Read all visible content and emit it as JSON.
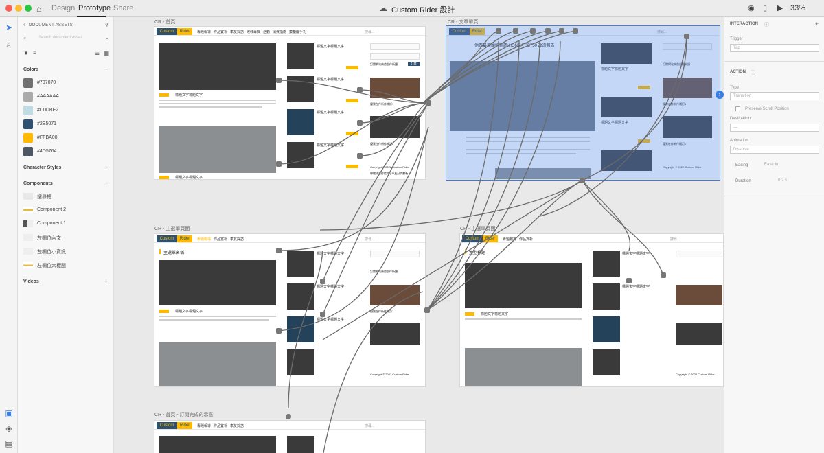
{
  "app": {
    "title": "Custom Rider 設計",
    "tabs": [
      "Design",
      "Prototype",
      "Share"
    ],
    "active_tab": "Prototype",
    "zoom": "33%"
  },
  "assets": {
    "header": "DOCUMENT ASSETS",
    "search_placeholder": "Search document asset",
    "sections": {
      "colors": "Colors",
      "character_styles": "Character Styles",
      "components": "Components",
      "videos": "Videos"
    },
    "colors": [
      {
        "hex": "#707070",
        "label": "#707070"
      },
      {
        "hex": "#AAAAAA",
        "label": "#AAAAAA"
      },
      {
        "hex": "#C0DBE2",
        "label": "#C0DBE2"
      },
      {
        "hex": "#2E5071",
        "label": "#2E5071"
      },
      {
        "hex": "#FFBA00",
        "label": "#FFBA00"
      },
      {
        "hex": "#4D5764",
        "label": "#4D5764"
      }
    ],
    "components": [
      "搜尋框",
      "Component 2",
      "Component 1",
      "左欄位內文",
      "左欄位小資訊",
      "左欄位大標題"
    ]
  },
  "artboards": {
    "home": "CR - 首頁",
    "article": "CR - 文章單頁",
    "topic": "CR - 主選單頁面",
    "topic2": "CR - 主選單頁面",
    "subscribed": "CR - 首頁 - 訂閱完成的示意"
  },
  "site": {
    "logo_a": "Custom",
    "logo_b": "Rider",
    "nav": [
      "專題報導",
      "作品賞析",
      "車友採訪",
      "改裝專欄",
      "活動",
      "消費指南",
      "摸轆籠手札"
    ],
    "search_placeholder": "搜尋...",
    "post_title": "標題文字標題文字",
    "subscribe": "訂閱網站來首部作新鐘",
    "subscribe_btn": "訂閱",
    "promo1": "優質在作新作補訂1",
    "promo2": "優質在作新作補訂2",
    "copyright": "Copyright © 2022 Custom Rider",
    "footer_links": "聯絡成合作信件 | 車友分院翻新",
    "topic_heading": "主選單名稱",
    "article_title": "他西最美麗的凱西:HONDA CB750 改造報告",
    "more": "大型標題"
  },
  "interaction": {
    "title": "INTERACTION",
    "trigger_label": "Trigger",
    "trigger_value": "Tap",
    "action_title": "ACTION",
    "type_label": "Type",
    "type_value": "Transition",
    "preserve": "Preserve Scroll Position",
    "destination_label": "Destination",
    "destination_value": "—",
    "animation_label": "Animation",
    "animation_value": "Dissolve",
    "easing_label": "Easing",
    "easing_value": "Ease In",
    "duration_label": "Duration",
    "duration_value": "0.2 s"
  },
  "accent": "#3b7de0"
}
